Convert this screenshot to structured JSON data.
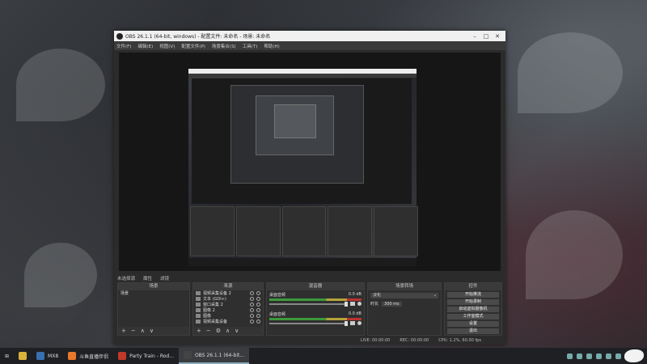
{
  "window": {
    "title": "OBS 26.1.1 (64-bit, windows) - 配置文件: 未命名 - 场景: 未命名",
    "controls": [
      "–",
      "□",
      "✕"
    ]
  },
  "menu": [
    "文件(F)",
    "编辑(E)",
    "视图(V)",
    "配置文件(P)",
    "场景集合(S)",
    "工具(T)",
    "帮助(H)"
  ],
  "controls_row": {
    "no_source": "未选择源",
    "properties": "属性",
    "filters": "滤镜"
  },
  "docks": {
    "scenes": {
      "header": "场景",
      "items": [
        "场景"
      ]
    },
    "sources": {
      "header": "来源",
      "items": [
        "视频采集设备 2",
        "文本 (GDI+)",
        "窗口采集 2",
        "图像 2",
        "图像",
        "视频采集设备"
      ]
    },
    "mixer": {
      "header": "混音器",
      "tracks": [
        {
          "name": "桌面音频",
          "db": "0.0 dB",
          "level": 0.84
        },
        {
          "name": "桌面音频",
          "db": "0.0 dB",
          "level": 0.84
        }
      ]
    },
    "transitions": {
      "header": "场景转场",
      "selected": "淡化",
      "duration_label": "时长",
      "duration": "300 ms"
    },
    "controls": {
      "header": "控件",
      "buttons": [
        "开始推流",
        "开始录制",
        "启动虚拟摄像机",
        "工作室模式",
        "设置",
        "退出"
      ]
    }
  },
  "statusbar": {
    "live": "LIVE: 00:00:00",
    "rec": "REC: 00:00:00",
    "cpu": "CPU: 1.2%, 60.00 fps"
  },
  "taskbar": {
    "items": [
      {
        "label": "MX8",
        "color": "#3a6fb0"
      },
      {
        "label": "斗鱼直播伴侣",
        "color": "#e8782a"
      },
      {
        "label": "Party Train - Rod...",
        "color": "#c0392b"
      },
      {
        "label": "OBS 26.1.1 (64-bit...",
        "color": "#444444"
      }
    ]
  }
}
